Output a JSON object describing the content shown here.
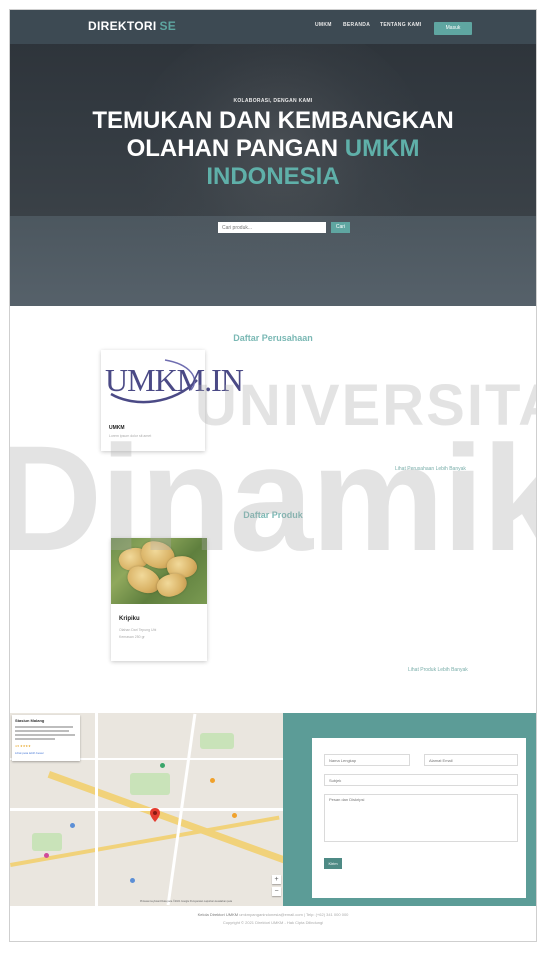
{
  "nav": {
    "brand_main": "DIREKTORI",
    "brand_accent": "SE",
    "links": [
      "UMKM",
      "BERANDA",
      "TENTANG KAMI"
    ],
    "login_label": "Masuk"
  },
  "hero": {
    "eyebrow": "KOLABORASI, DENGAN KAMI",
    "title_line1": "TEMUKAN DAN KEMBANGKAN",
    "title_line2_a": "OLAHAN PANGAN",
    "title_line2_b": "UMKM",
    "title_line3": "INDONESIA",
    "search_placeholder": "Cari produk...",
    "search_button": "Cari"
  },
  "companies": {
    "title": "Daftar Perusahaan",
    "logo_text": "UMKM.IN",
    "items": [
      {
        "name": "UMKM",
        "sub": "Lorem ipsum dolor sit amet"
      }
    ],
    "more_link": "Lihat Perusahaan Lebih Banyak"
  },
  "products": {
    "title": "Daftar Produk",
    "items": [
      {
        "name": "Kripiku",
        "line1": "Olahan Dari Tepung Ubi",
        "line2": "Kemasan 250 gr"
      }
    ],
    "more_link": "Lihat Produk Lebih Banyak"
  },
  "map": {
    "place_title": "Stasiun Malang",
    "rating": "4.5 ★★★★",
    "view_link": "Lihat peta lebih besar",
    "footer": "Pintasan keyboard   Data peta ©2021 Google   Persyaratan   Laporkan kesalahan peta"
  },
  "contact": {
    "name_placeholder": "Nama Lengkap",
    "email_placeholder": "Alamat Email",
    "subject_placeholder": "Subjek",
    "message_placeholder": "Pesan dan Diskripsi",
    "send_label": "Kirim"
  },
  "footer": {
    "line1_a": "Kelola Direktori UMKM",
    "line1_b": "umkmpanganindonesia@email.com | Telp: (+62) 341 000 000",
    "line2": "Copyright © 2021 Direktori UMKM - Hak Cipta Dilindungi"
  },
  "watermark": {
    "line1": "UNIVERSITAS",
    "line2": "Dinamika"
  }
}
